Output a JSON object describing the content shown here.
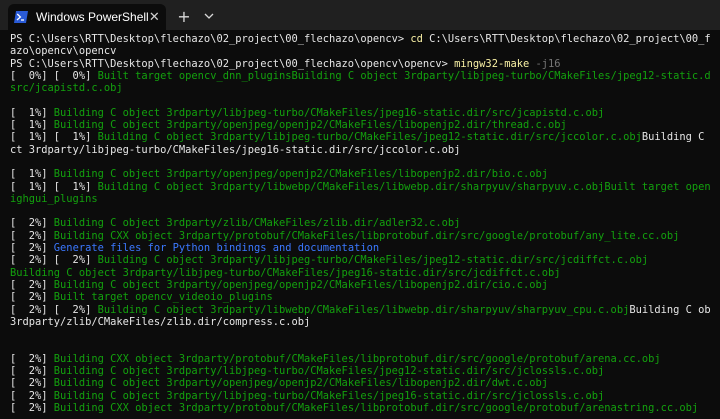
{
  "window": {
    "tab_title": "Windows PowerShell",
    "close_glyph": "✕",
    "new_tab_glyph": "+",
    "dropdown_glyph": "⌄"
  },
  "colors": {
    "title_bar": "#202020",
    "terminal_bg": "#0c0c0c",
    "progress_green": "#16c60c",
    "build_green": "#13a10e",
    "generate_blue": "#3b78ff",
    "command_yellow": "#f9f1a5"
  },
  "terminal": {
    "lines": [
      [
        {
          "t": "PS C:\\Users\\RTT\\Desktop\\flechazo\\02_project\\00_flechazo\\opencv> ",
          "c": "white"
        },
        {
          "t": "cd ",
          "c": "yellow"
        },
        {
          "t": "C:\\Users\\RTT\\Desktop\\flechazo\\02_project\\00_flech",
          "c": "white"
        }
      ],
      [
        {
          "t": "azo\\opencv\\opencv",
          "c": "white"
        }
      ],
      [
        {
          "t": "PS C:\\Users\\RTT\\Desktop\\flechazo\\02_project\\00_flechazo\\opencv\\opencv> ",
          "c": "white"
        },
        {
          "t": "mingw32-make ",
          "c": "yellow"
        },
        {
          "t": "-j16",
          "c": "gray"
        }
      ],
      [
        {
          "t": "[  0%] [  0%] ",
          "c": "white"
        },
        {
          "t": "Built target opencv_dnn_plugins",
          "c": "dgreen"
        },
        {
          "t": "Building C object 3rdparty/libjpeg-turbo/CMakeFiles/jpeg12-static.dir/",
          "c": "dgreen"
        }
      ],
      [
        {
          "t": "src/jcapistd.c.obj",
          "c": "dgreen"
        }
      ],
      [],
      [
        {
          "t": "[  1%] ",
          "c": "white"
        },
        {
          "t": "Building C object 3rdparty/libjpeg-turbo/CMakeFiles/jpeg16-static.dir/src/jcapistd.c.obj",
          "c": "dgreen"
        }
      ],
      [
        {
          "t": "[  1%] ",
          "c": "white"
        },
        {
          "t": "Building C object 3rdparty/openjpeg/openjp2/CMakeFiles/libopenjp2.dir/thread.c.obj",
          "c": "dgreen"
        }
      ],
      [
        {
          "t": "[  1%] [  1%] ",
          "c": "white"
        },
        {
          "t": "Building C object 3rdparty/libjpeg-turbo/CMakeFiles/jpeg12-static.dir/src/jccolor.c.obj",
          "c": "dgreen"
        },
        {
          "t": "Building C obje",
          "c": "white"
        }
      ],
      [
        {
          "t": "ct 3rdparty/libjpeg-turbo/CMakeFiles/jpeg16-static.dir/src/jccolor.c.obj",
          "c": "white"
        }
      ],
      [],
      [
        {
          "t": "[  1%] ",
          "c": "white"
        },
        {
          "t": "Building C object 3rdparty/openjpeg/openjp2/CMakeFiles/libopenjp2.dir/bio.c.obj",
          "c": "dgreen"
        }
      ],
      [
        {
          "t": "[  1%] [  1%] ",
          "c": "white"
        },
        {
          "t": "Building C object 3rdparty/libwebp/CMakeFiles/libwebp.dir/sharpyuv/sharpyuv.c.obj",
          "c": "dgreen"
        },
        {
          "t": "Built target opencv_h",
          "c": "dgreen"
        }
      ],
      [
        {
          "t": "ighgui_plugins",
          "c": "dgreen"
        }
      ],
      [],
      [
        {
          "t": "[  2%] ",
          "c": "white"
        },
        {
          "t": "Building C object 3rdparty/zlib/CMakeFiles/zlib.dir/adler32.c.obj",
          "c": "dgreen"
        }
      ],
      [
        {
          "t": "[  2%] ",
          "c": "white"
        },
        {
          "t": "Building CXX object 3rdparty/protobuf/CMakeFiles/libprotobuf.dir/src/google/protobuf/any_lite.cc.obj",
          "c": "dgreen"
        }
      ],
      [
        {
          "t": "[  2%] ",
          "c": "white"
        },
        {
          "t": "Generate files for Python bindings and documentation",
          "c": "blue"
        }
      ],
      [
        {
          "t": "[  2%] [  2%] ",
          "c": "white"
        },
        {
          "t": "Building C object 3rdparty/libjpeg-turbo/CMakeFiles/jpeg12-static.dir/src/jcdiffct.c.obj",
          "c": "dgreen"
        }
      ],
      [
        {
          "t": "Building C object 3rdparty/libjpeg-turbo/CMakeFiles/jpeg16-static.dir/src/jcdiffct.c.obj",
          "c": "dgreen"
        }
      ],
      [
        {
          "t": "[  2%] ",
          "c": "white"
        },
        {
          "t": "Building C object 3rdparty/openjpeg/openjp2/CMakeFiles/libopenjp2.dir/cio.c.obj",
          "c": "dgreen"
        }
      ],
      [
        {
          "t": "[  2%] ",
          "c": "white"
        },
        {
          "t": "Built target opencv_videoio_plugins",
          "c": "dgreen"
        }
      ],
      [
        {
          "t": "[  2%] [  2%] ",
          "c": "white"
        },
        {
          "t": "Building C object 3rdparty/libwebp/CMakeFiles/libwebp.dir/sharpyuv/sharpyuv_cpu.c.obj",
          "c": "dgreen"
        },
        {
          "t": "Building C objec",
          "c": "white"
        }
      ],
      [
        {
          "t": "3rdparty/zlib/CMakeFiles/zlib.dir/compress.c.obj",
          "c": "white"
        }
      ],
      [],
      [],
      [
        {
          "t": "[  2%] ",
          "c": "white"
        },
        {
          "t": "Building CXX object 3rdparty/protobuf/CMakeFiles/libprotobuf.dir/src/google/protobuf/arena.cc.obj",
          "c": "dgreen"
        }
      ],
      [
        {
          "t": "[  2%] ",
          "c": "white"
        },
        {
          "t": "Building C object 3rdparty/libjpeg-turbo/CMakeFiles/jpeg12-static.dir/src/jclossls.c.obj",
          "c": "dgreen"
        }
      ],
      [
        {
          "t": "[  2%] ",
          "c": "white"
        },
        {
          "t": "Building C object 3rdparty/openjpeg/openjp2/CMakeFiles/libopenjp2.dir/dwt.c.obj",
          "c": "dgreen"
        }
      ],
      [
        {
          "t": "[  2%] ",
          "c": "white"
        },
        {
          "t": "Building C object 3rdparty/libjpeg-turbo/CMakeFiles/jpeg16-static.dir/src/jclossls.c.obj",
          "c": "dgreen"
        }
      ],
      [
        {
          "t": "[  2%] ",
          "c": "white"
        },
        {
          "t": "Building CXX object 3rdparty/protobuf/CMakeFiles/libprotobuf.dir/src/google/protobuf/arenastring.cc.obj",
          "c": "dgreen"
        }
      ]
    ]
  }
}
